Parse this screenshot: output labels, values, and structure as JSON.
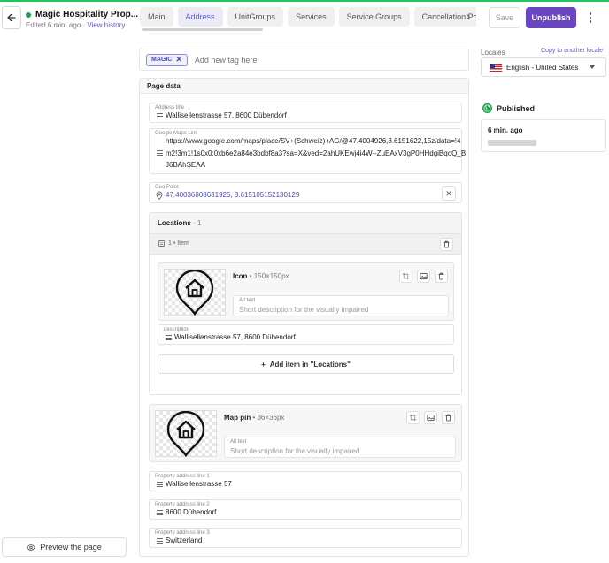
{
  "header": {
    "title": "Magic Hospitality Prop...",
    "edited": "Edited 6 min. ago",
    "separator": " · ",
    "view_history": "View history",
    "save_label": "Save",
    "unpublish_label": "Unpublish"
  },
  "tabs": [
    {
      "label": "Main",
      "active": false
    },
    {
      "label": "Address",
      "active": true
    },
    {
      "label": "UnitGroups",
      "active": false
    },
    {
      "label": "Services",
      "active": false
    },
    {
      "label": "Service Groups",
      "active": false
    },
    {
      "label": "Cancellation Po",
      "active": false
    }
  ],
  "tags": {
    "items": [
      "MAGIC"
    ],
    "placeholder": "Add new tag here"
  },
  "page_data": {
    "heading": "Page data",
    "address_title": {
      "label": "Address title",
      "value": "Wallisellenstrasse 57, 8600 Dübendorf"
    },
    "maps_link": {
      "label": "Google Maps Link",
      "value": "https://www.google.com/maps/place/SV+(Schweiz)+AG/@47.4004926,8.6151622,15z/data=!4m2!3m1!1s0x0:0xb6e2a84e3bdbf8a3?sa=X&ved=2ahUKEwj4i4W--ZuEAxV3gP0HHdgiBqoQ_BJ6BAhSEAA"
    },
    "geo_point": {
      "label": "Geo Point",
      "value": "47.40036808631925, 8.615105152130129"
    },
    "locations": {
      "title": "Locations",
      "count": "· 1",
      "item_label": "1 • Item",
      "icon": {
        "name": "Icon",
        "dims": "• 150×150px",
        "alt_label": "Alt text",
        "alt_placeholder": "Short description for the visually impaired"
      },
      "description": {
        "label": "description",
        "value": "Wallisellenstrasse 57, 8600 Dübendorf"
      },
      "add_item": "Add item in \"Locations\""
    },
    "map_pin": {
      "name": "Map pin",
      "dims": "• 36×36px",
      "alt_label": "Alt text",
      "alt_placeholder": "Short description for the visually impaired"
    },
    "line1": {
      "label": "Property address line 1",
      "value": "Wallisellenstrasse 57"
    },
    "line2": {
      "label": "Property address line 2",
      "value": "8600 Dübendorf"
    },
    "line3": {
      "label": "Property address line 3",
      "value": "Switzerland"
    }
  },
  "sidebar": {
    "locales_label": "Locales",
    "copy_link": "Copy to another locale",
    "locale_value": "English - United States",
    "published_label": "Published",
    "published_time": "6 min. ago"
  },
  "preview_label": "Preview the page",
  "colors": {
    "accent": "#6b46c1",
    "link": "#5b5bd6",
    "status_green": "#16a34a"
  }
}
